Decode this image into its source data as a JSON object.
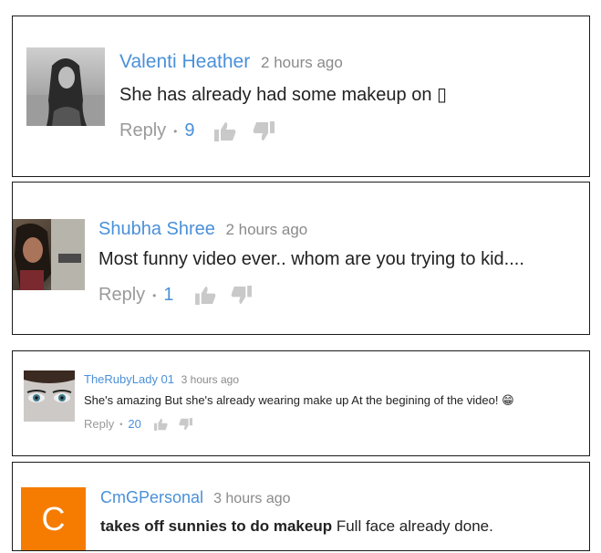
{
  "comments": [
    {
      "author": "Valenti Heather",
      "time": "2 hours ago",
      "text": "She has already had some makeup on ▯",
      "reply_label": "Reply",
      "separator": "•",
      "like_count": "9"
    },
    {
      "author": "Shubha Shree",
      "time": "2 hours ago",
      "text": "Most funny video ever.. whom are you trying to kid....",
      "reply_label": "Reply",
      "separator": "•",
      "like_count": "1"
    },
    {
      "author": "TheRubyLady 01",
      "time": "3 hours ago",
      "text": "She's amazing But she's already wearing make up At the begining of the video! 😁",
      "reply_label": "Reply",
      "separator": "•",
      "like_count": "20"
    },
    {
      "author": "CmGPersonal",
      "time": "3 hours ago",
      "text_bold": "takes off sunnies to do makeup",
      "text_rest": " Full face already done.",
      "avatar_letter": "C",
      "avatar_color": "#f57c00"
    }
  ],
  "colors": {
    "author": "#4a90d9",
    "meta": "#8a8a8a",
    "text": "#222222"
  },
  "icons": [
    "thumbs-up-icon",
    "thumbs-down-icon"
  ]
}
